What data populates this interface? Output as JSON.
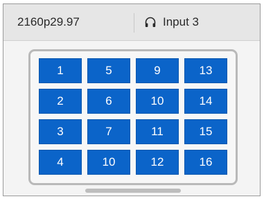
{
  "header": {
    "format": "2160p29.97",
    "input_icon": "headphones-icon",
    "input_label": "Input 3"
  },
  "grid": {
    "buttons": [
      "1",
      "5",
      "9",
      "13",
      "2",
      "6",
      "10",
      "14",
      "3",
      "7",
      "11",
      "15",
      "4",
      "10",
      "12",
      "16"
    ]
  },
  "colors": {
    "button_bg": "#0b64c9",
    "button_text": "#ffffff",
    "header_bg": "#e6e6e6"
  }
}
